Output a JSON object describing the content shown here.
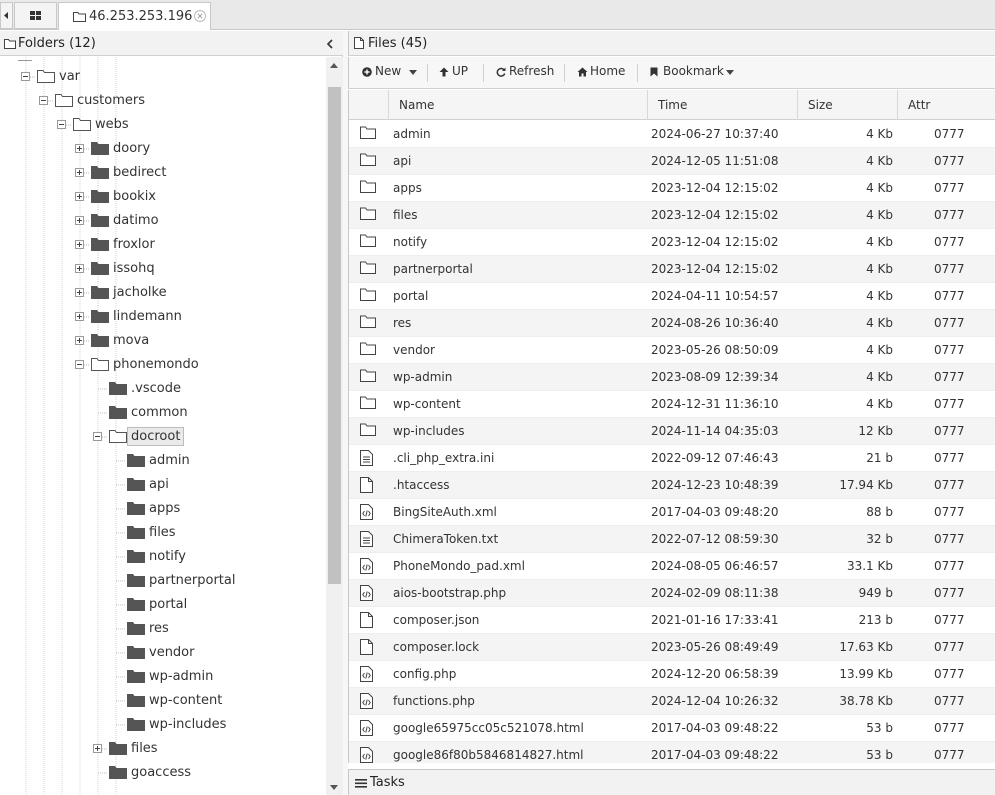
{
  "tab": {
    "host": "46.253.253.196"
  },
  "folders_panel": {
    "title": "Folders (12)"
  },
  "tree": [
    {
      "label": "var",
      "level": 1,
      "expander": "minus",
      "open": true
    },
    {
      "label": "customers",
      "level": 2,
      "expander": "minus",
      "open": true
    },
    {
      "label": "webs",
      "level": 3,
      "expander": "minus",
      "open": true
    },
    {
      "label": "doory",
      "level": 4,
      "expander": "plus",
      "open": false
    },
    {
      "label": "bedirect",
      "level": 4,
      "expander": "plus",
      "open": false
    },
    {
      "label": "bookix",
      "level": 4,
      "expander": "plus",
      "open": false
    },
    {
      "label": "datimo",
      "level": 4,
      "expander": "plus",
      "open": false
    },
    {
      "label": "froxlor",
      "level": 4,
      "expander": "plus",
      "open": false
    },
    {
      "label": "issohq",
      "level": 4,
      "expander": "plus",
      "open": false
    },
    {
      "label": "jacholke",
      "level": 4,
      "expander": "plus",
      "open": false
    },
    {
      "label": "lindemann",
      "level": 4,
      "expander": "plus",
      "open": false
    },
    {
      "label": "mova",
      "level": 4,
      "expander": "plus",
      "open": false
    },
    {
      "label": "phonemondo",
      "level": 4,
      "expander": "minus",
      "open": true
    },
    {
      "label": ".vscode",
      "level": 5,
      "expander": "none",
      "open": false
    },
    {
      "label": "common",
      "level": 5,
      "expander": "none",
      "open": false
    },
    {
      "label": "docroot",
      "level": 5,
      "expander": "minus",
      "open": true,
      "selected": true
    },
    {
      "label": "admin",
      "level": 6,
      "expander": "none",
      "open": false
    },
    {
      "label": "api",
      "level": 6,
      "expander": "none",
      "open": false
    },
    {
      "label": "apps",
      "level": 6,
      "expander": "none",
      "open": false
    },
    {
      "label": "files",
      "level": 6,
      "expander": "none",
      "open": false
    },
    {
      "label": "notify",
      "level": 6,
      "expander": "none",
      "open": false
    },
    {
      "label": "partnerportal",
      "level": 6,
      "expander": "none",
      "open": false
    },
    {
      "label": "portal",
      "level": 6,
      "expander": "none",
      "open": false
    },
    {
      "label": "res",
      "level": 6,
      "expander": "none",
      "open": false
    },
    {
      "label": "vendor",
      "level": 6,
      "expander": "none",
      "open": false
    },
    {
      "label": "wp-admin",
      "level": 6,
      "expander": "none",
      "open": false
    },
    {
      "label": "wp-content",
      "level": 6,
      "expander": "none",
      "open": false
    },
    {
      "label": "wp-includes",
      "level": 6,
      "expander": "none",
      "open": false
    },
    {
      "label": "files",
      "level": 5,
      "expander": "plus",
      "open": false
    },
    {
      "label": "goaccess",
      "level": 5,
      "expander": "none",
      "open": false
    }
  ],
  "files_panel": {
    "title": "Files (45)"
  },
  "toolbar": {
    "new_label": "New",
    "up_label": "UP",
    "refresh_label": "Refresh",
    "home_label": "Home",
    "bookmark_label": "Bookmark"
  },
  "columns": {
    "name": "Name",
    "time": "Time",
    "size": "Size",
    "attr": "Attr"
  },
  "files": [
    {
      "icon": "folder",
      "name": "admin",
      "time": "2024-06-27 10:37:40",
      "size": "4 Kb",
      "attr": "0777"
    },
    {
      "icon": "folder",
      "name": "api",
      "time": "2024-12-05 11:51:08",
      "size": "4 Kb",
      "attr": "0777"
    },
    {
      "icon": "folder",
      "name": "apps",
      "time": "2023-12-04 12:15:02",
      "size": "4 Kb",
      "attr": "0777"
    },
    {
      "icon": "folder",
      "name": "files",
      "time": "2023-12-04 12:15:02",
      "size": "4 Kb",
      "attr": "0777"
    },
    {
      "icon": "folder",
      "name": "notify",
      "time": "2023-12-04 12:15:02",
      "size": "4 Kb",
      "attr": "0777"
    },
    {
      "icon": "folder",
      "name": "partnerportal",
      "time": "2023-12-04 12:15:02",
      "size": "4 Kb",
      "attr": "0777"
    },
    {
      "icon": "folder",
      "name": "portal",
      "time": "2024-04-11 10:54:57",
      "size": "4 Kb",
      "attr": "0777"
    },
    {
      "icon": "folder",
      "name": "res",
      "time": "2024-08-26 10:36:40",
      "size": "4 Kb",
      "attr": "0777"
    },
    {
      "icon": "folder",
      "name": "vendor",
      "time": "2023-05-26 08:50:09",
      "size": "4 Kb",
      "attr": "0777"
    },
    {
      "icon": "folder",
      "name": "wp-admin",
      "time": "2023-08-09 12:39:34",
      "size": "4 Kb",
      "attr": "0777"
    },
    {
      "icon": "folder",
      "name": "wp-content",
      "time": "2024-12-31 11:36:10",
      "size": "4 Kb",
      "attr": "0777"
    },
    {
      "icon": "folder",
      "name": "wp-includes",
      "time": "2024-11-14 04:35:03",
      "size": "12 Kb",
      "attr": "0777"
    },
    {
      "icon": "text",
      "name": ".cli_php_extra.ini",
      "time": "2022-09-12 07:46:43",
      "size": "21 b",
      "attr": "0777"
    },
    {
      "icon": "blank",
      "name": ".htaccess",
      "time": "2024-12-23 10:48:39",
      "size": "17.94 Kb",
      "attr": "0777"
    },
    {
      "icon": "code",
      "name": "BingSiteAuth.xml",
      "time": "2017-04-03 09:48:20",
      "size": "88 b",
      "attr": "0777"
    },
    {
      "icon": "text",
      "name": "ChimeraToken.txt",
      "time": "2022-07-12 08:59:30",
      "size": "32 b",
      "attr": "0777"
    },
    {
      "icon": "code",
      "name": "PhoneMondo_pad.xml",
      "time": "2024-08-05 06:46:57",
      "size": "33.1 Kb",
      "attr": "0777"
    },
    {
      "icon": "code",
      "name": "aios-bootstrap.php",
      "time": "2024-02-09 08:11:38",
      "size": "949 b",
      "attr": "0777"
    },
    {
      "icon": "blank",
      "name": "composer.json",
      "time": "2021-01-16 17:33:41",
      "size": "213 b",
      "attr": "0777"
    },
    {
      "icon": "blank",
      "name": "composer.lock",
      "time": "2023-05-26 08:49:49",
      "size": "17.63 Kb",
      "attr": "0777"
    },
    {
      "icon": "code",
      "name": "config.php",
      "time": "2024-12-20 06:58:39",
      "size": "13.99 Kb",
      "attr": "0777"
    },
    {
      "icon": "code",
      "name": "functions.php",
      "time": "2024-12-04 10:26:32",
      "size": "38.78 Kb",
      "attr": "0777"
    },
    {
      "icon": "code",
      "name": "google65975cc05c521078.html",
      "time": "2017-04-03 09:48:22",
      "size": "53 b",
      "attr": "0777"
    },
    {
      "icon": "code",
      "name": "google86f80b5846814827.html",
      "time": "2017-04-03 09:48:22",
      "size": "53 b",
      "attr": "0777"
    }
  ],
  "tasks_panel": {
    "title": "Tasks"
  }
}
